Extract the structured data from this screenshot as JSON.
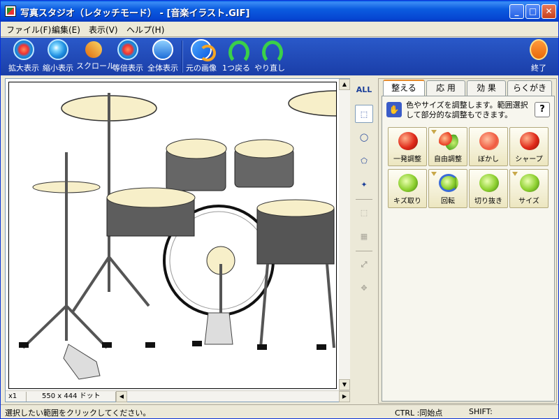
{
  "window": {
    "title": "写真スタジオ（レタッチモード） - [音楽イラスト.GIF]",
    "minimize": "_",
    "maximize": "□",
    "close": "✕"
  },
  "menu": [
    "ファイル(F)",
    "編集(E)",
    "表示(V)",
    "ヘルプ(H)"
  ],
  "toolbar": {
    "zoom_in": "拡大表示",
    "zoom_out": "縮小表示",
    "scroll": "スクロール",
    "actual_size": "等倍表示",
    "fit_all": "全体表示",
    "original": "元の画像",
    "undo": "1つ戻る",
    "redo": "やり直し",
    "exit": "終了"
  },
  "canvas_status": {
    "zoom": "x1",
    "dimensions": "550 x 444 ドット"
  },
  "tools": {
    "select_all": "ALL"
  },
  "tabs": [
    "整える",
    "応 用",
    "効 果",
    "らくがき"
  ],
  "panel": {
    "description": "色やサイズを調整します。範囲選択して部分的な調整もできます。",
    "help": "?",
    "buttons": [
      "一発調整",
      "自由調整",
      "ぼかし",
      "シャープ",
      "キズ取り",
      "回転",
      "切り抜き",
      "サイズ"
    ]
  },
  "status": {
    "message": "選択したい範囲をクリックしてください。",
    "ctrl": "CTRL :同始点",
    "shift": "SHIFT:"
  }
}
